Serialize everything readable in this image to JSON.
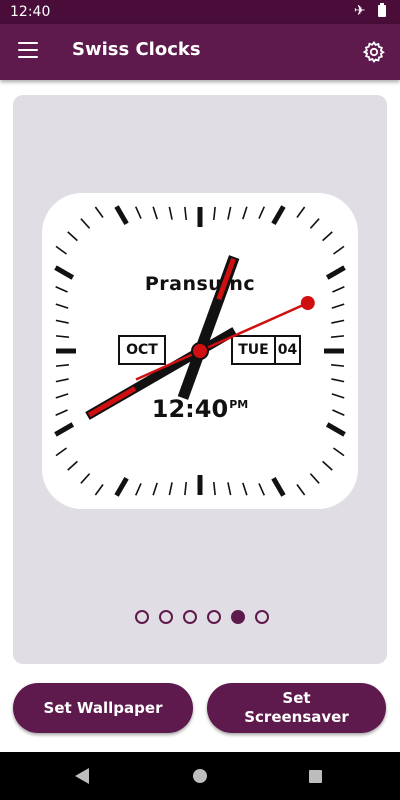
{
  "status_bar": {
    "time": "12:40",
    "icons": [
      "airplane-mode-icon",
      "battery-icon"
    ]
  },
  "app_bar": {
    "title": "Swiss Clocks",
    "menu_icon": "hamburger-menu-icon",
    "settings_icon": "gear-icon"
  },
  "clock": {
    "brand": "Pransuinc",
    "month": "OCT",
    "weekday": "TUE",
    "day": "04",
    "time": "12:40",
    "ampm": "PM",
    "hands": {
      "hour": 0,
      "minute": 40,
      "second": 11
    },
    "colors": {
      "face": "#ffffff",
      "hands": "#111111",
      "second_hand": "#d01010"
    }
  },
  "pager": {
    "count": 6,
    "active_index": 4
  },
  "actions": {
    "set_wallpaper": "Set Wallpaper",
    "set_screensaver_line1": "Set",
    "set_screensaver_line2": "Screensaver"
  },
  "nav_bar": {
    "icons": [
      "back-icon",
      "home-icon",
      "recents-icon"
    ]
  },
  "colors": {
    "status_bar": "#4a0d39",
    "app_bar": "#5e1a4c",
    "card_background": "#e1dde4",
    "button": "#5e1a4c"
  }
}
